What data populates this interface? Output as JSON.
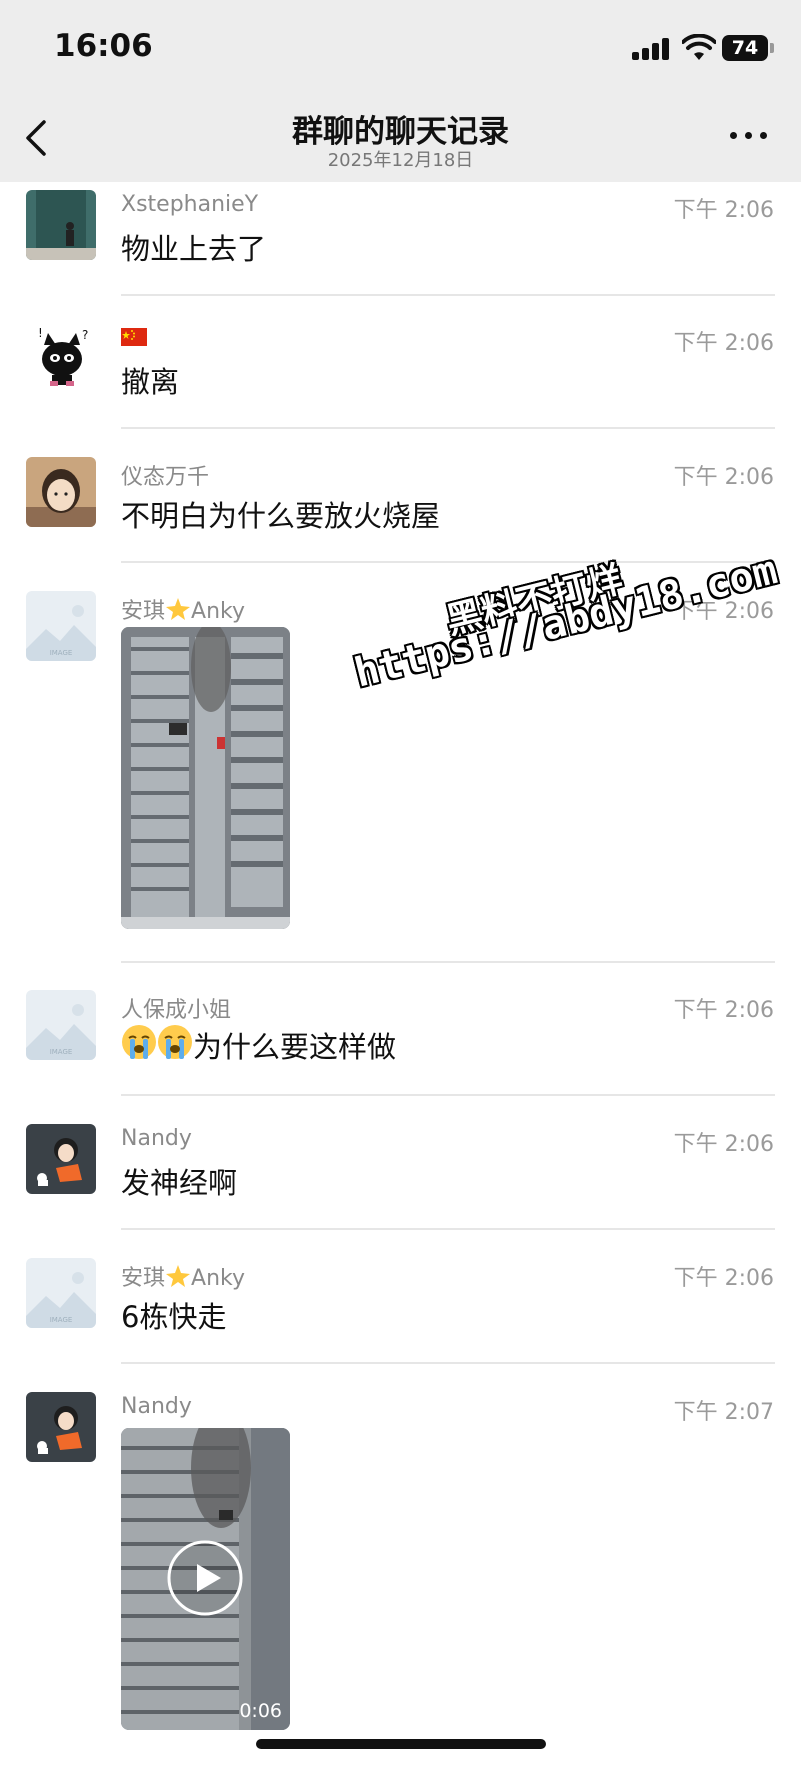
{
  "status_bar": {
    "time": "16:06",
    "battery": "74"
  },
  "nav": {
    "title": "群聊的聊天记录",
    "subtitle": "2025年12月18日"
  },
  "messages": [
    {
      "sender": "XstephanieY",
      "time": "下午 2:06",
      "text": "物业上去了"
    },
    {
      "sender": "🇨🇳",
      "time": "下午 2:06",
      "text": "撤离"
    },
    {
      "sender": "仪态万千",
      "time": "下午 2:06",
      "text": "不明白为什么要放火烧屋"
    },
    {
      "sender": "安琪",
      "sender_suffix": "Anky",
      "time": "下午 2:06",
      "image": "building-fire-photo"
    },
    {
      "sender": "人保成小姐",
      "time": "下午 2:06",
      "text": "为什么要这样做"
    },
    {
      "sender": "Nandy",
      "time": "下午 2:06",
      "text": "发神经啊"
    },
    {
      "sender": "安琪",
      "sender_suffix": "Anky",
      "time": "下午 2:06",
      "text": "6栋快走"
    },
    {
      "sender": "Nandy",
      "time": "下午 2:07",
      "video_duration": "0:06"
    }
  ],
  "placeholder_avatar_text": "IMAGE",
  "watermark": {
    "line1": "黑料不打烊",
    "line2": "https://abdy18.com"
  },
  "colors": {
    "nav_bg": "#ededed",
    "divider": "#e6e6e6",
    "muted_text": "#8a8a8a"
  }
}
